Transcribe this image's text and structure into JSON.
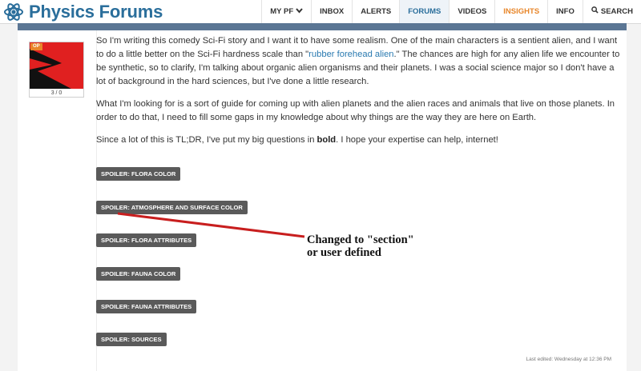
{
  "header": {
    "logo_text": "Physics Forums",
    "nav": [
      {
        "label": "MY PF",
        "has_chevron": true
      },
      {
        "label": "INBOX"
      },
      {
        "label": "ALERTS"
      },
      {
        "label": "FORUMS",
        "active": true
      },
      {
        "label": "VIDEOS"
      },
      {
        "label": "INSIGHTS",
        "highlight": true
      },
      {
        "label": "INFO"
      },
      {
        "label": "SEARCH",
        "icon": "search-icon"
      }
    ]
  },
  "post": {
    "op_badge": "OP",
    "avatar_count": "3 / 0",
    "paragraph1": {
      "before_link": "So I'm writing this comedy Sci-Fi story and I want it to have some realism. One of the main characters is a sentient alien, and I want to do a little better on the Sci-Fi hardness scale than \"",
      "link_text": "rubber forehead alien",
      "after_link": ".\" The chances are high for any alien life we encounter to be synthetic, so to clarify, I'm talking about organic alien organisms and their planets. I was a social science major so I don't have a lot of background in the hard sciences, but I've done a little research."
    },
    "paragraph2": "What I'm looking for is a sort of guide for coming up with alien planets and the alien races and animals that live on those planets. In order to do that, I need to fill some gaps in my knowledge about why things are the way they are here on Earth.",
    "paragraph3": {
      "before_bold": "Since a lot of this is TL;DR, I've put my big questions in ",
      "bold": "bold",
      "after_bold": ". I hope your expertise can help, internet!"
    },
    "spoilers": [
      "SPOILER: FLORA COLOR",
      "SPOILER: ATMOSPHERE AND SURFACE COLOR",
      "SPOILER: FLORA ATTRIBUTES",
      "SPOILER: FAUNA COLOR",
      "SPOILER: FAUNA ATTRIBUTES",
      "SPOILER: SOURCES"
    ],
    "last_edited": "Last edited: Wednesday at 12:36 PM"
  },
  "annotation": {
    "line1": "Changed to \"section\"",
    "line2": "or user defined",
    "color": "#c81e1e"
  },
  "colors": {
    "brand": "#2a6e9b",
    "insights": "#e8862a",
    "spoiler_bg": "#5a5a5a"
  }
}
